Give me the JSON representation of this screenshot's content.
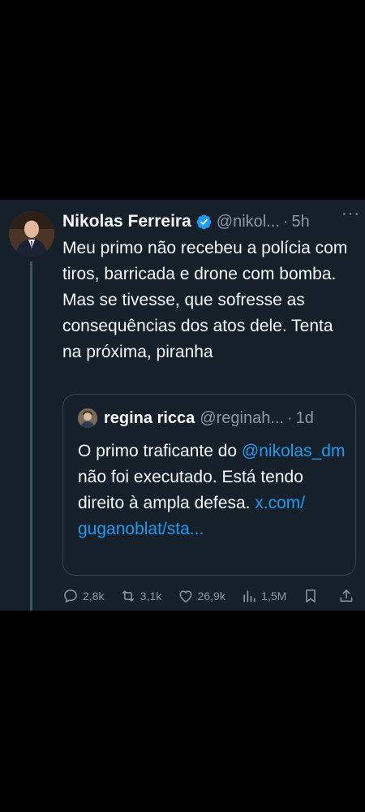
{
  "tweet": {
    "author_name": "Nikolas Ferreira",
    "handle": "@nikol...",
    "separator": "·",
    "time": "5h",
    "more_label": "···",
    "text": "Meu primo não recebeu a polícia com tiros, barricada e drone com bomba. Mas se tivesse, que sofresse as consequências dos atos dele. Tenta na próxima, piranha"
  },
  "quote": {
    "author_name": "regina ricca",
    "handle": "@reginah...",
    "separator": "·",
    "time": "1d",
    "text_part1": "O primo traficante do ",
    "mention": "@nikolas_dm",
    "text_part2": " não foi executado. Está tendo direito à ampla defesa. ",
    "link": "x.com/ guganoblat/sta..."
  },
  "actions": {
    "replies": "2,8k",
    "retweets": "3,1k",
    "likes": "26,9k",
    "views": "1,5M"
  },
  "colors": {
    "background": "#000000",
    "card": "#15202b",
    "text": "#f7f9f9",
    "secondary": "#8b98a5",
    "link": "#1d9bf0",
    "verified": "#1d9bf0",
    "border": "#38444d"
  },
  "icons": [
    "verified-badge-icon",
    "more-options-icon",
    "reply-icon",
    "retweet-icon",
    "like-icon",
    "views-icon",
    "bookmark-icon",
    "share-icon"
  ]
}
